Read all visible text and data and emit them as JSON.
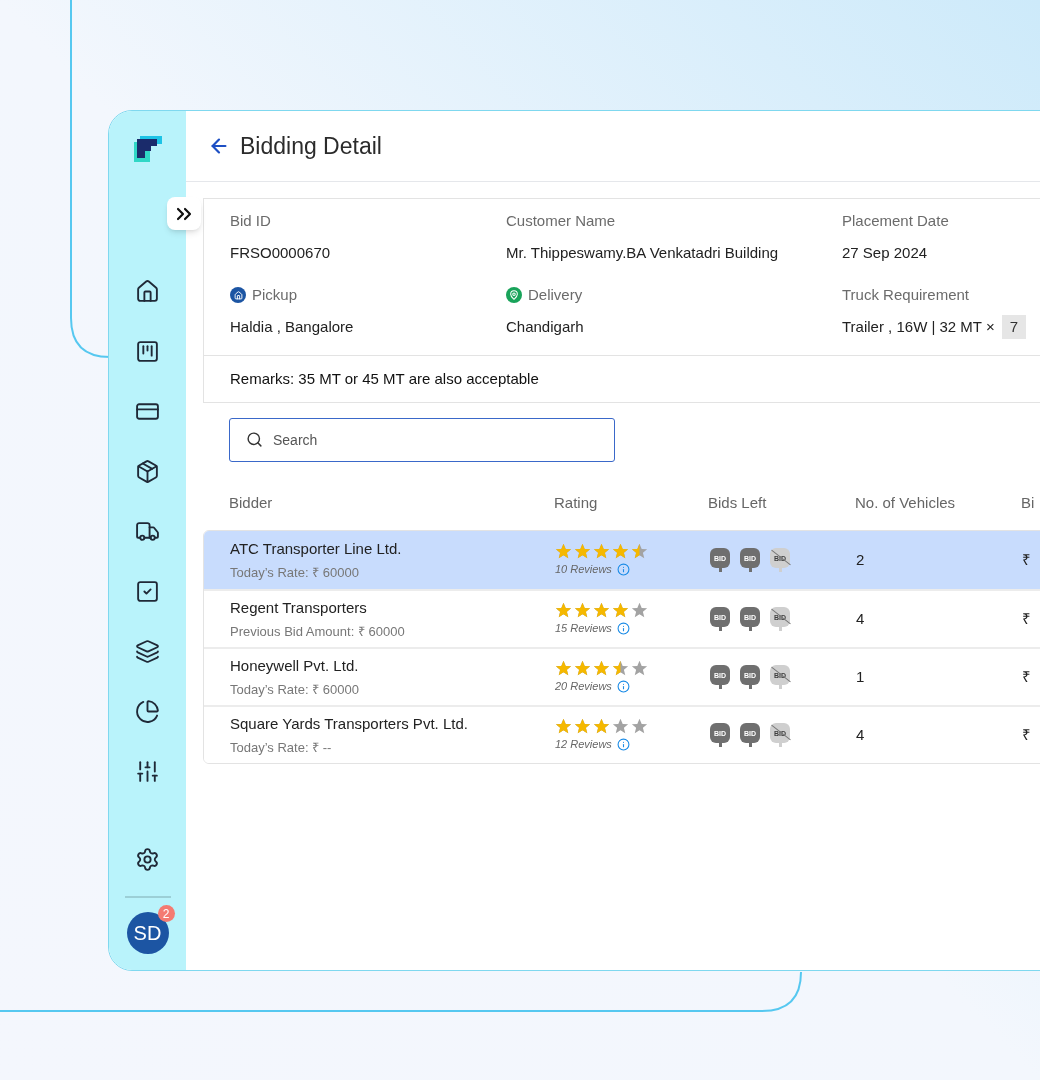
{
  "header": {
    "title": "Bidding Detail"
  },
  "details": {
    "fields": [
      {
        "kind": "plain",
        "label": "Bid ID",
        "value": "FRSO0000670"
      },
      {
        "kind": "plain",
        "label": "Customer Name",
        "value": "Mr. Thippeswamy.BA Venkatadri Building"
      },
      {
        "kind": "plain",
        "label": "Placement Date",
        "value": "27 Sep 2024"
      },
      {
        "kind": "pickup",
        "label": "Pickup",
        "value": "Haldia , Bangalore"
      },
      {
        "kind": "delivery",
        "label": "Delivery",
        "value": "Chandigarh"
      },
      {
        "kind": "count",
        "label": "Truck Requirement",
        "value": "Trailer , 16W | 32 MT ×",
        "count": "7"
      }
    ],
    "remarks": "Remarks: 35 MT or 45 MT are also acceptable"
  },
  "search": {
    "placeholder": "Search"
  },
  "table": {
    "columns": [
      "Bidder",
      "Rating",
      "Bids Left",
      "No. of Vehicles",
      "Bi"
    ],
    "rows": [
      {
        "selected": true,
        "bidder": "ATC Transporter Line Ltd.",
        "rate": "Today’s Rate: ₹ 60000",
        "stars": 4.5,
        "reviews": "10 Reviews",
        "bids_left": [
          {
            "label": "BID",
            "available": true
          },
          {
            "label": "BID",
            "available": true
          },
          {
            "label": "BID",
            "available": false
          }
        ],
        "vehicles": "2",
        "column_5": "₹"
      },
      {
        "selected": false,
        "bidder": "Regent Transporters",
        "rate": "Previous Bid Amount: ₹ 60000",
        "stars": 4,
        "reviews": "15 Reviews",
        "bids_left": [
          {
            "label": "BID",
            "available": true
          },
          {
            "label": "BID",
            "available": true
          },
          {
            "label": "BID",
            "available": false
          }
        ],
        "vehicles": "4",
        "column_5": "₹"
      },
      {
        "selected": false,
        "bidder": "Honeywell Pvt. Ltd.",
        "rate": "Today’s Rate: ₹ 60000",
        "stars": 3.5,
        "reviews": "20 Reviews",
        "bids_left": [
          {
            "label": "BID",
            "available": true
          },
          {
            "label": "BID",
            "available": true
          },
          {
            "label": "BID",
            "available": false
          }
        ],
        "vehicles": "1",
        "column_5": "₹"
      },
      {
        "selected": false,
        "bidder": "Square Yards Transporters Pvt. Ltd.",
        "rate": "Today’s Rate: ₹ --",
        "stars": 3,
        "reviews": "12 Reviews",
        "bids_left": [
          {
            "label": "BID",
            "available": true
          },
          {
            "label": "BID",
            "available": true
          },
          {
            "label": "BID",
            "available": false
          }
        ],
        "vehicles": "4",
        "column_5": "₹"
      }
    ]
  },
  "user": {
    "initials": "SD",
    "notifications": "2"
  }
}
